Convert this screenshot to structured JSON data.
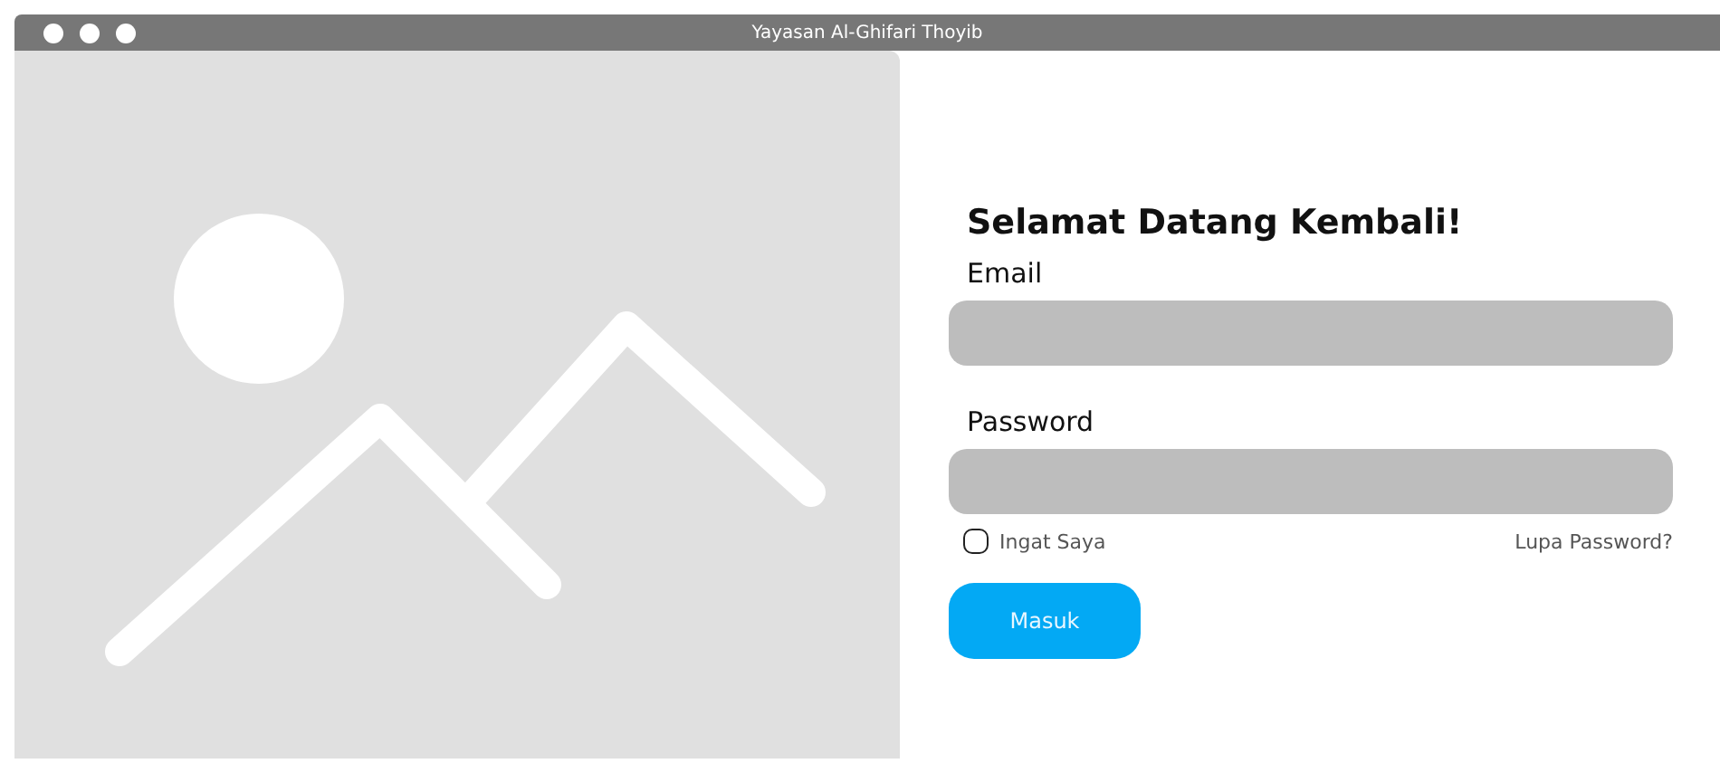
{
  "window": {
    "title": "Yayasan Al-Ghifari Thoyib"
  },
  "login": {
    "heading": "Selamat Datang Kembali!",
    "fields": [
      {
        "label": "Email"
      },
      {
        "label": "Password"
      }
    ],
    "remember": {
      "label": "Ingat Saya",
      "checked": false
    },
    "forgot": "Lupa Password?",
    "submit": "Masuk"
  }
}
